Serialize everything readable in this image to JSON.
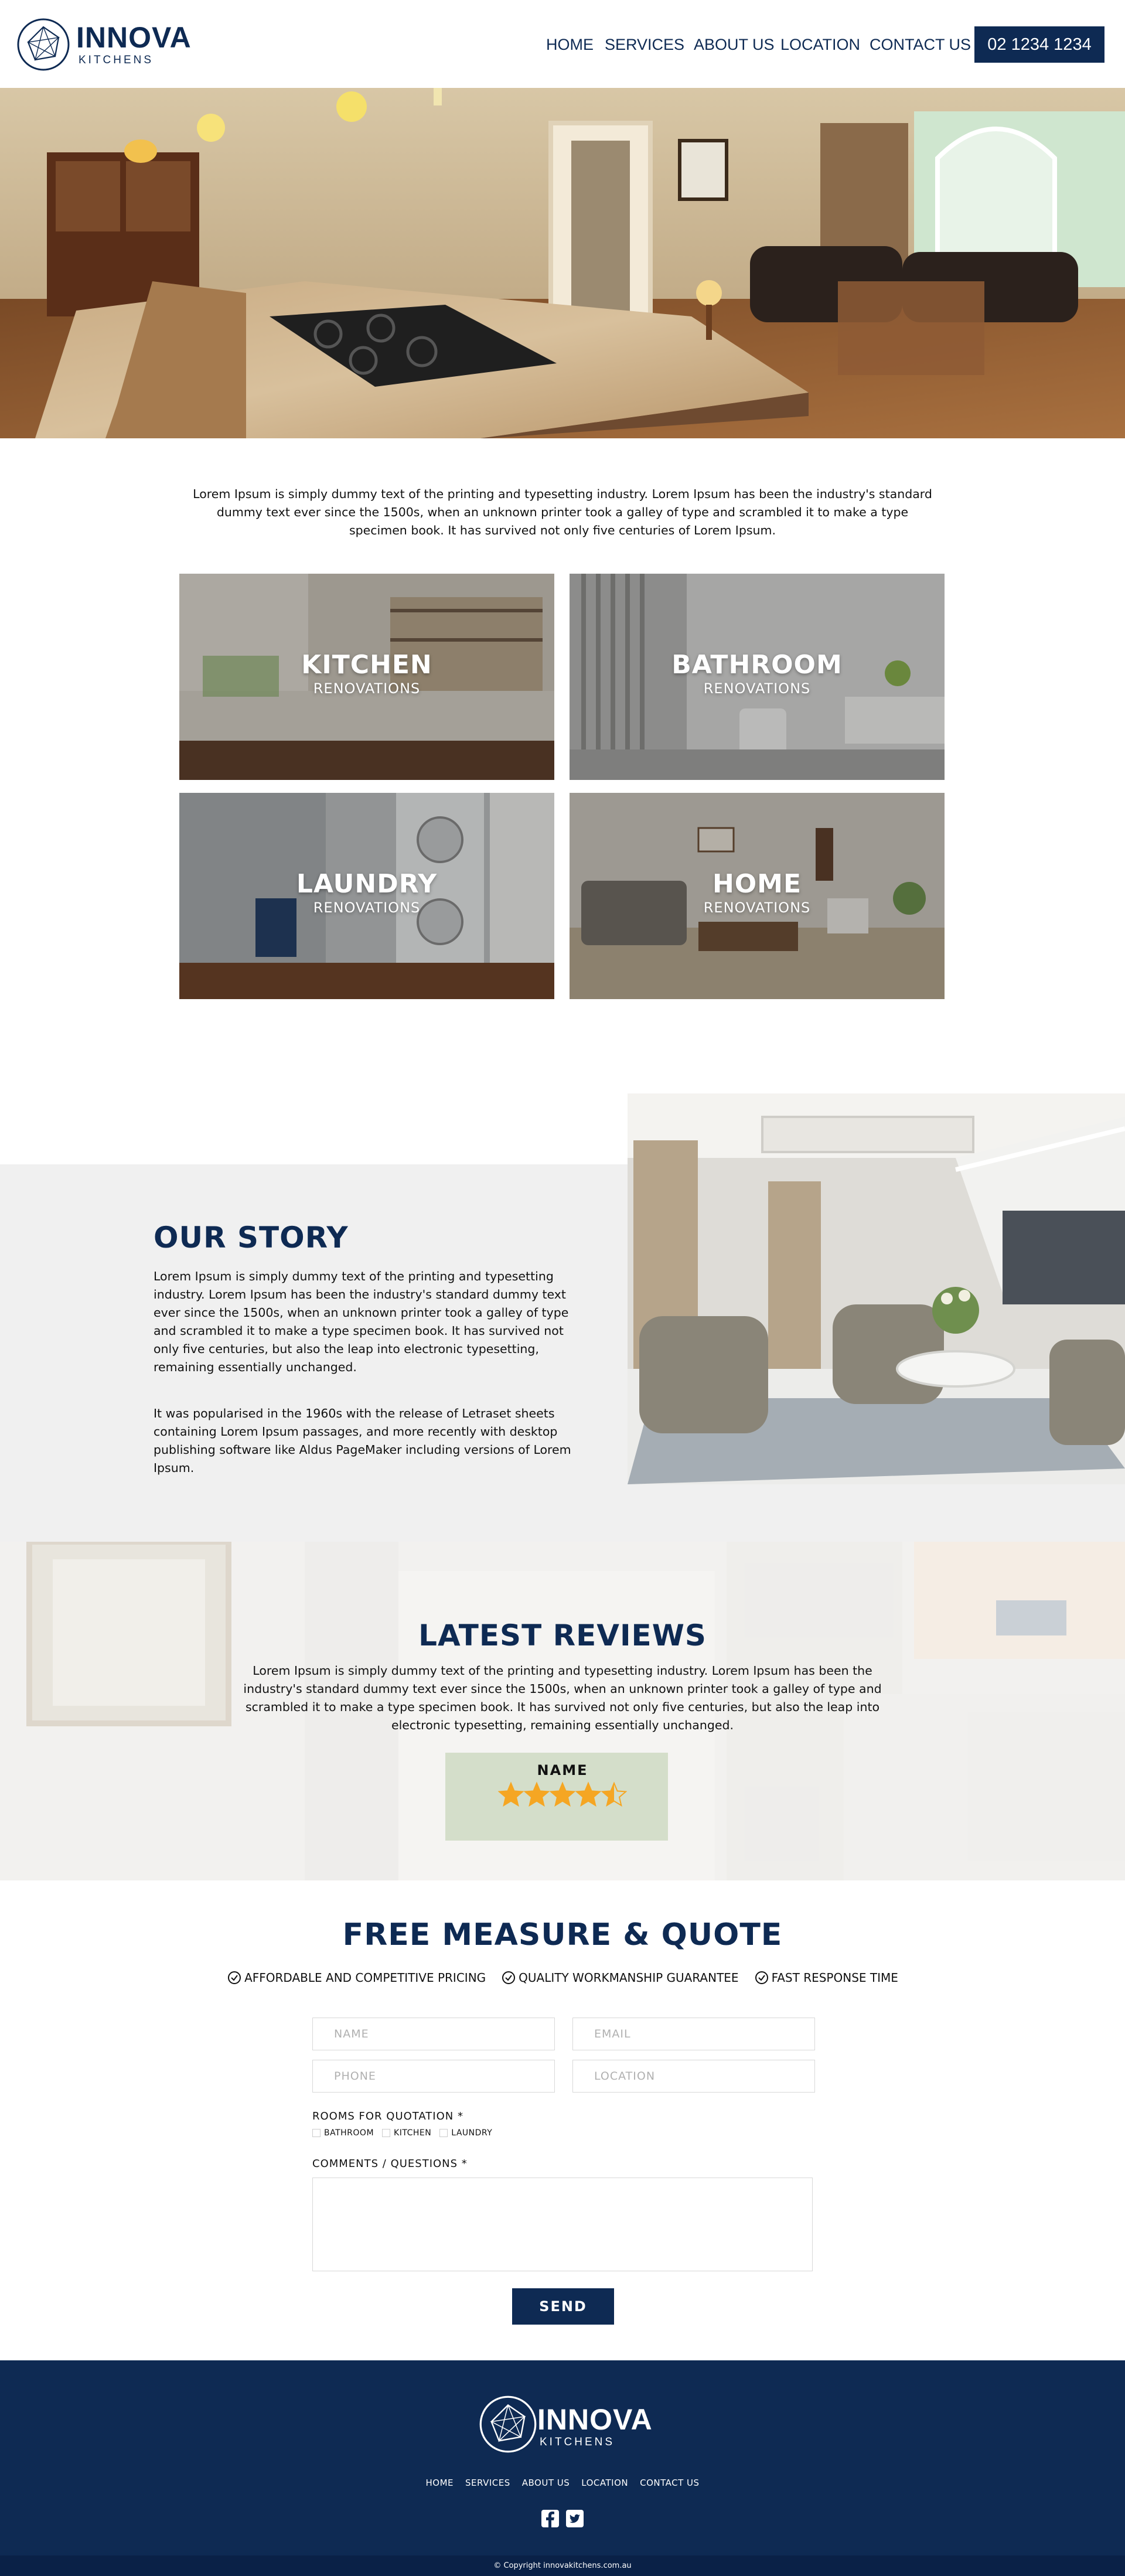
{
  "brand": {
    "name": "INNOVA",
    "tagline": "KITCHENS",
    "navy": "#0e2a53"
  },
  "nav": {
    "home": "HOME",
    "services": "SERVICES",
    "about": "ABOUT US",
    "location": "LOCATION",
    "contact": "CONTACT US",
    "phone": "02 1234 1234"
  },
  "intro": {
    "text": "Lorem Ipsum is simply dummy text of the printing and typesetting industry. Lorem Ipsum has been the industry's standard dummy text ever since the 1500s, when an unknown printer took a galley of type and scrambled it to make a type specimen book. It has survived not only five centuries  of Lorem Ipsum."
  },
  "tiles": [
    {
      "title": "KITCHEN",
      "subtitle": "RENOVATIONS"
    },
    {
      "title": "BATHROOM",
      "subtitle": "RENOVATIONS"
    },
    {
      "title": "LAUNDRY",
      "subtitle": "RENOVATIONS"
    },
    {
      "title": "HOME",
      "subtitle": "RENOVATIONS"
    }
  ],
  "story": {
    "title": "OUR STORY",
    "paragraph1": "Lorem Ipsum is simply dummy text of the printing and typesetting industry. Lorem Ipsum has been the industry's standard dummy text ever since the 1500s, when an unknown printer took a galley of type and scrambled it to make a type specimen book. It has survived not only five centuries, but also the leap into electronic typesetting, remaining essentially unchanged.",
    "paragraph2": "It was popularised in the 1960s with the release of Letraset sheets containing Lorem Ipsum passages, and more recently with desktop publishing software like Aldus PageMaker including versions of Lorem Ipsum."
  },
  "reviews": {
    "title": "LATEST REVIEWS",
    "text": "Lorem Ipsum is simply dummy text of the printing and typesetting industry. Lorem Ipsum has been the industry's standard dummy text ever since the 1500s, when an unknown printer took a galley of type and scrambled it to make a type specimen book. It has survived not only five centuries, but also the leap into electronic typesetting, remaining essentially unchanged.",
    "name": "NAME",
    "rating": 4.5,
    "rating_max": 5,
    "star_color": "#f5a623"
  },
  "quote": {
    "title": "FREE MEASURE & QUOTE",
    "benefits": [
      "AFFORDABLE AND COMPETITIVE PRICING",
      "QUALITY WORKMANSHIP GUARANTEE",
      "FAST RESPONSE TIME"
    ],
    "name_placeholder": "NAME",
    "email_placeholder": "EMAIL",
    "phone_placeholder": "PHONE",
    "location_placeholder": "LOCATION",
    "rooms_label": "ROOMS FOR QUOTATION *",
    "rooms": [
      "BATHROOM",
      "KITCHEN",
      "LAUNDRY"
    ],
    "comments_label": "COMMENTS / QUESTIONS *",
    "send_label": "SEND"
  },
  "footer": {
    "nav": [
      "HOME",
      "SERVICES",
      "ABOUT US",
      "LOCATION",
      "CONTACT US"
    ],
    "social": [
      "facebook-icon",
      "twitter-icon"
    ],
    "copyright": "© Copyright innovakitchens.com.au"
  }
}
